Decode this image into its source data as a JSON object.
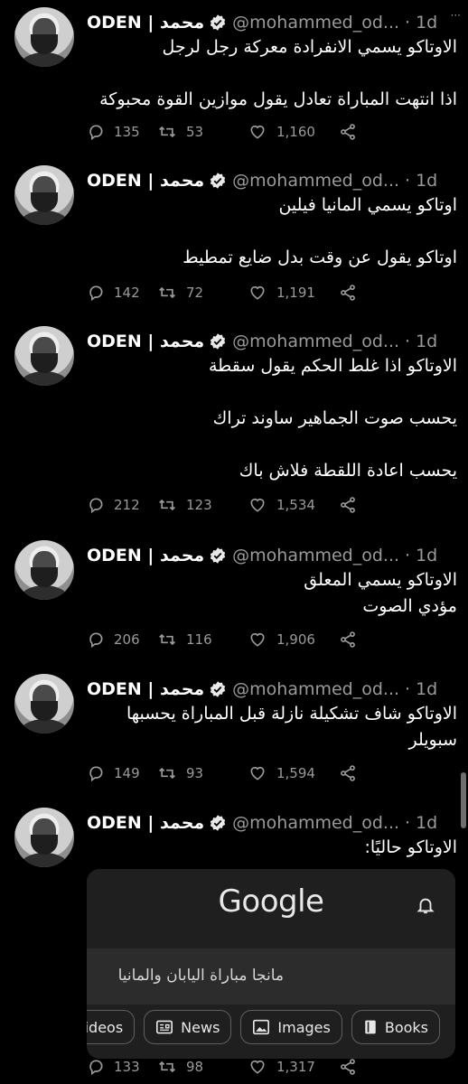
{
  "tweets": [
    {
      "author": "ODEN | محمد",
      "handle": "@mohammed_od...",
      "time": "1d",
      "lines": [
        "الاوتاكو يسمي الانفرادة معركة رجل لرجل",
        "اذا انتهت المباراة تعادل يقول موازين القوة محبوكة"
      ],
      "replies": "135",
      "retweets": "53",
      "likes": "1,160"
    },
    {
      "author": "ODEN | محمد",
      "handle": "@mohammed_od...",
      "time": "1d",
      "lines": [
        "اوتاكو يسمي المانيا فيلين",
        "اوتاكو يقول عن وقت بدل ضايع تمطيط"
      ],
      "replies": "142",
      "retweets": "72",
      "likes": "1,191"
    },
    {
      "author": "ODEN | محمد",
      "handle": "@mohammed_od...",
      "time": "1d",
      "lines": [
        "الاوتاكو اذا غلط الحكم يقول سقطة",
        "يحسب صوت الجماهير ساوند تراك",
        "يحسب اعادة اللقطة فلاش باك"
      ],
      "replies": "212",
      "retweets": "123",
      "likes": "1,534"
    },
    {
      "author": "ODEN | محمد",
      "handle": "@mohammed_od...",
      "time": "1d",
      "lines": [
        "الاوتاكو يسمي المعلق",
        "مؤدي الصوت"
      ],
      "replies": "206",
      "retweets": "116",
      "likes": "1,906"
    },
    {
      "author": "ODEN | محمد",
      "handle": "@mohammed_od...",
      "time": "1d",
      "lines": [
        "الاوتاكو شاف تشكيلة نازلة قبل المباراة يحسبها",
        "سبويلر"
      ],
      "replies": "149",
      "retweets": "93",
      "likes": "1,594"
    },
    {
      "author": "ODEN | محمد",
      "handle": "@mohammed_od...",
      "time": "1d",
      "lines": [
        "الاوتاكو حاليًا:"
      ],
      "replies": "133",
      "retweets": "98",
      "likes": "1,317"
    }
  ],
  "google_card": {
    "logo": "Google",
    "query": "مانجا مباراة اليابان والمانيا",
    "chips": [
      "Videos",
      "News",
      "Images",
      "Books"
    ]
  },
  "more_glyph": "···"
}
